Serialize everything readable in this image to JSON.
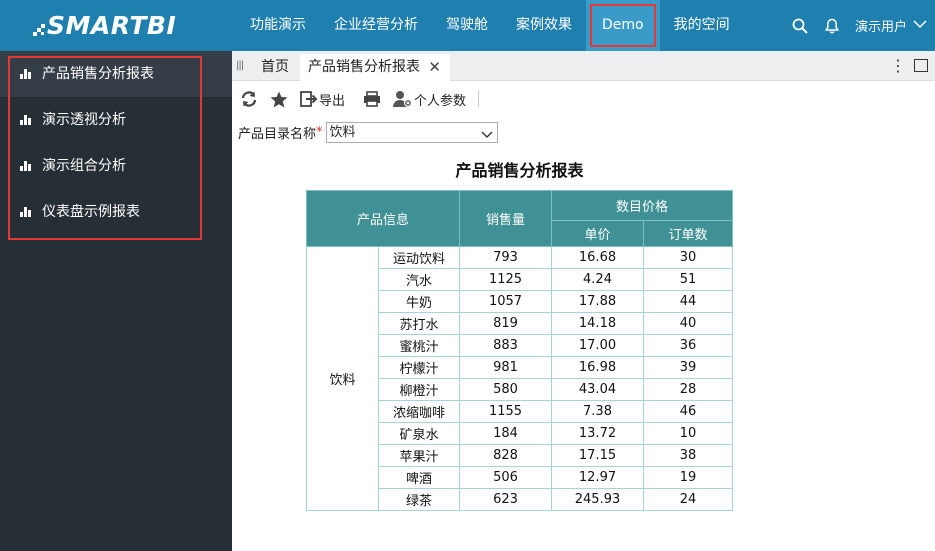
{
  "app": {
    "logo_text": "SMARTBI"
  },
  "nav": {
    "items": [
      {
        "label": "功能演示"
      },
      {
        "label": "企业经营分析"
      },
      {
        "label": "驾驶舱"
      },
      {
        "label": "案例效果"
      },
      {
        "label": "Demo",
        "active": true
      },
      {
        "label": "我的空间"
      }
    ],
    "user_label": "演示用户"
  },
  "sidebar": {
    "items": [
      {
        "label": "产品销售分析报表",
        "active": true
      },
      {
        "label": "演示透视分析"
      },
      {
        "label": "演示组合分析"
      },
      {
        "label": "仪表盘示例报表"
      }
    ]
  },
  "tabs": {
    "home_label": "首页",
    "report_label": "产品销售分析报表"
  },
  "toolbar": {
    "export_label": "导出",
    "params_label": "个人参数"
  },
  "param": {
    "label": "产品目录名称",
    "required_mark": "*",
    "value": "饮料"
  },
  "report": {
    "title": "产品销售分析报表",
    "headers": {
      "product_info": "产品信息",
      "sales": "销售量",
      "price_group": "数目价格",
      "unit_price": "单价",
      "order_count": "订单数"
    },
    "category": "饮料",
    "rows": [
      {
        "name": "运动饮料",
        "sales": "793",
        "price": "16.68",
        "orders": "30"
      },
      {
        "name": "汽水",
        "sales": "1125",
        "price": "4.24",
        "orders": "51"
      },
      {
        "name": "牛奶",
        "sales": "1057",
        "price": "17.88",
        "orders": "44"
      },
      {
        "name": "苏打水",
        "sales": "819",
        "price": "14.18",
        "orders": "40"
      },
      {
        "name": "蜜桃汁",
        "sales": "883",
        "price": "17.00",
        "orders": "36"
      },
      {
        "name": "柠檬汁",
        "sales": "981",
        "price": "16.98",
        "orders": "39"
      },
      {
        "name": "柳橙汁",
        "sales": "580",
        "price": "43.04",
        "orders": "28"
      },
      {
        "name": "浓缩咖啡",
        "sales": "1155",
        "price": "7.38",
        "orders": "46"
      },
      {
        "name": "矿泉水",
        "sales": "184",
        "price": "13.72",
        "orders": "10"
      },
      {
        "name": "苹果汁",
        "sales": "828",
        "price": "17.15",
        "orders": "38"
      },
      {
        "name": "啤酒",
        "sales": "506",
        "price": "12.97",
        "orders": "19"
      },
      {
        "name": "绿茶",
        "sales": "623",
        "price": "245.93",
        "orders": "24"
      }
    ]
  },
  "colors": {
    "topbar": "#1f7fae",
    "sidebar": "#272f36",
    "table_header": "#3f9196",
    "highlight": "#e53935"
  }
}
